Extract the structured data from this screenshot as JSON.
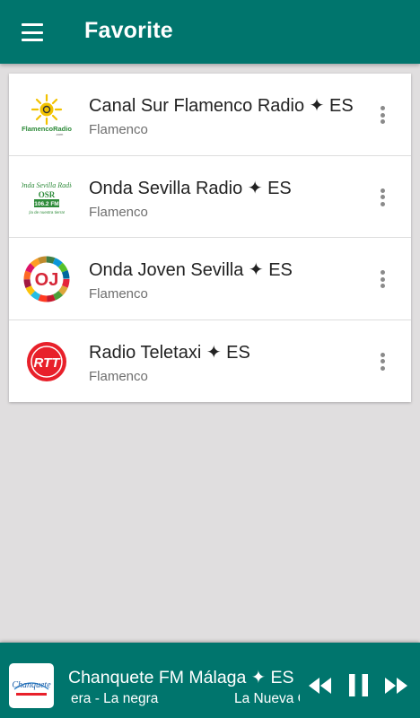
{
  "app_bar": {
    "title": "Favorite",
    "menu_icon": "hamburger-menu-icon",
    "color": "#00756d"
  },
  "stations": [
    {
      "name": "Canal Sur Flamenco Radio ✦ ES",
      "genre": "Flamenco",
      "logo_icon": "flamenco-radio-logo",
      "logo_text": "FlamencoRadio"
    },
    {
      "name": "Onda Sevilla Radio ✦ ES",
      "genre": "Flamenco",
      "logo_icon": "onda-sevilla-logo",
      "logo_text": [
        "Onda Sevilla Radio",
        "OSR",
        "106.2 FM",
        "¡la de nuestra tierra!"
      ]
    },
    {
      "name": "Onda Joven Sevilla ✦ ES",
      "genre": "Flamenco",
      "logo_icon": "onda-joven-logo",
      "logo_text": "OJ"
    },
    {
      "name": "Radio Teletaxi ✦ ES",
      "genre": "Flamenco",
      "logo_icon": "radio-teletaxi-logo",
      "logo_text": "RTT"
    }
  ],
  "player": {
    "station": "Chanquete FM Málaga ✦ ES",
    "now_playing_a": "era - La negra",
    "now_playing_b": "La Nueva C",
    "logo_icon": "chanquete-fm-logo",
    "logo_text": "Chanquete",
    "controls": [
      "rewind-icon",
      "pause-icon",
      "fast-forward-icon"
    ]
  }
}
